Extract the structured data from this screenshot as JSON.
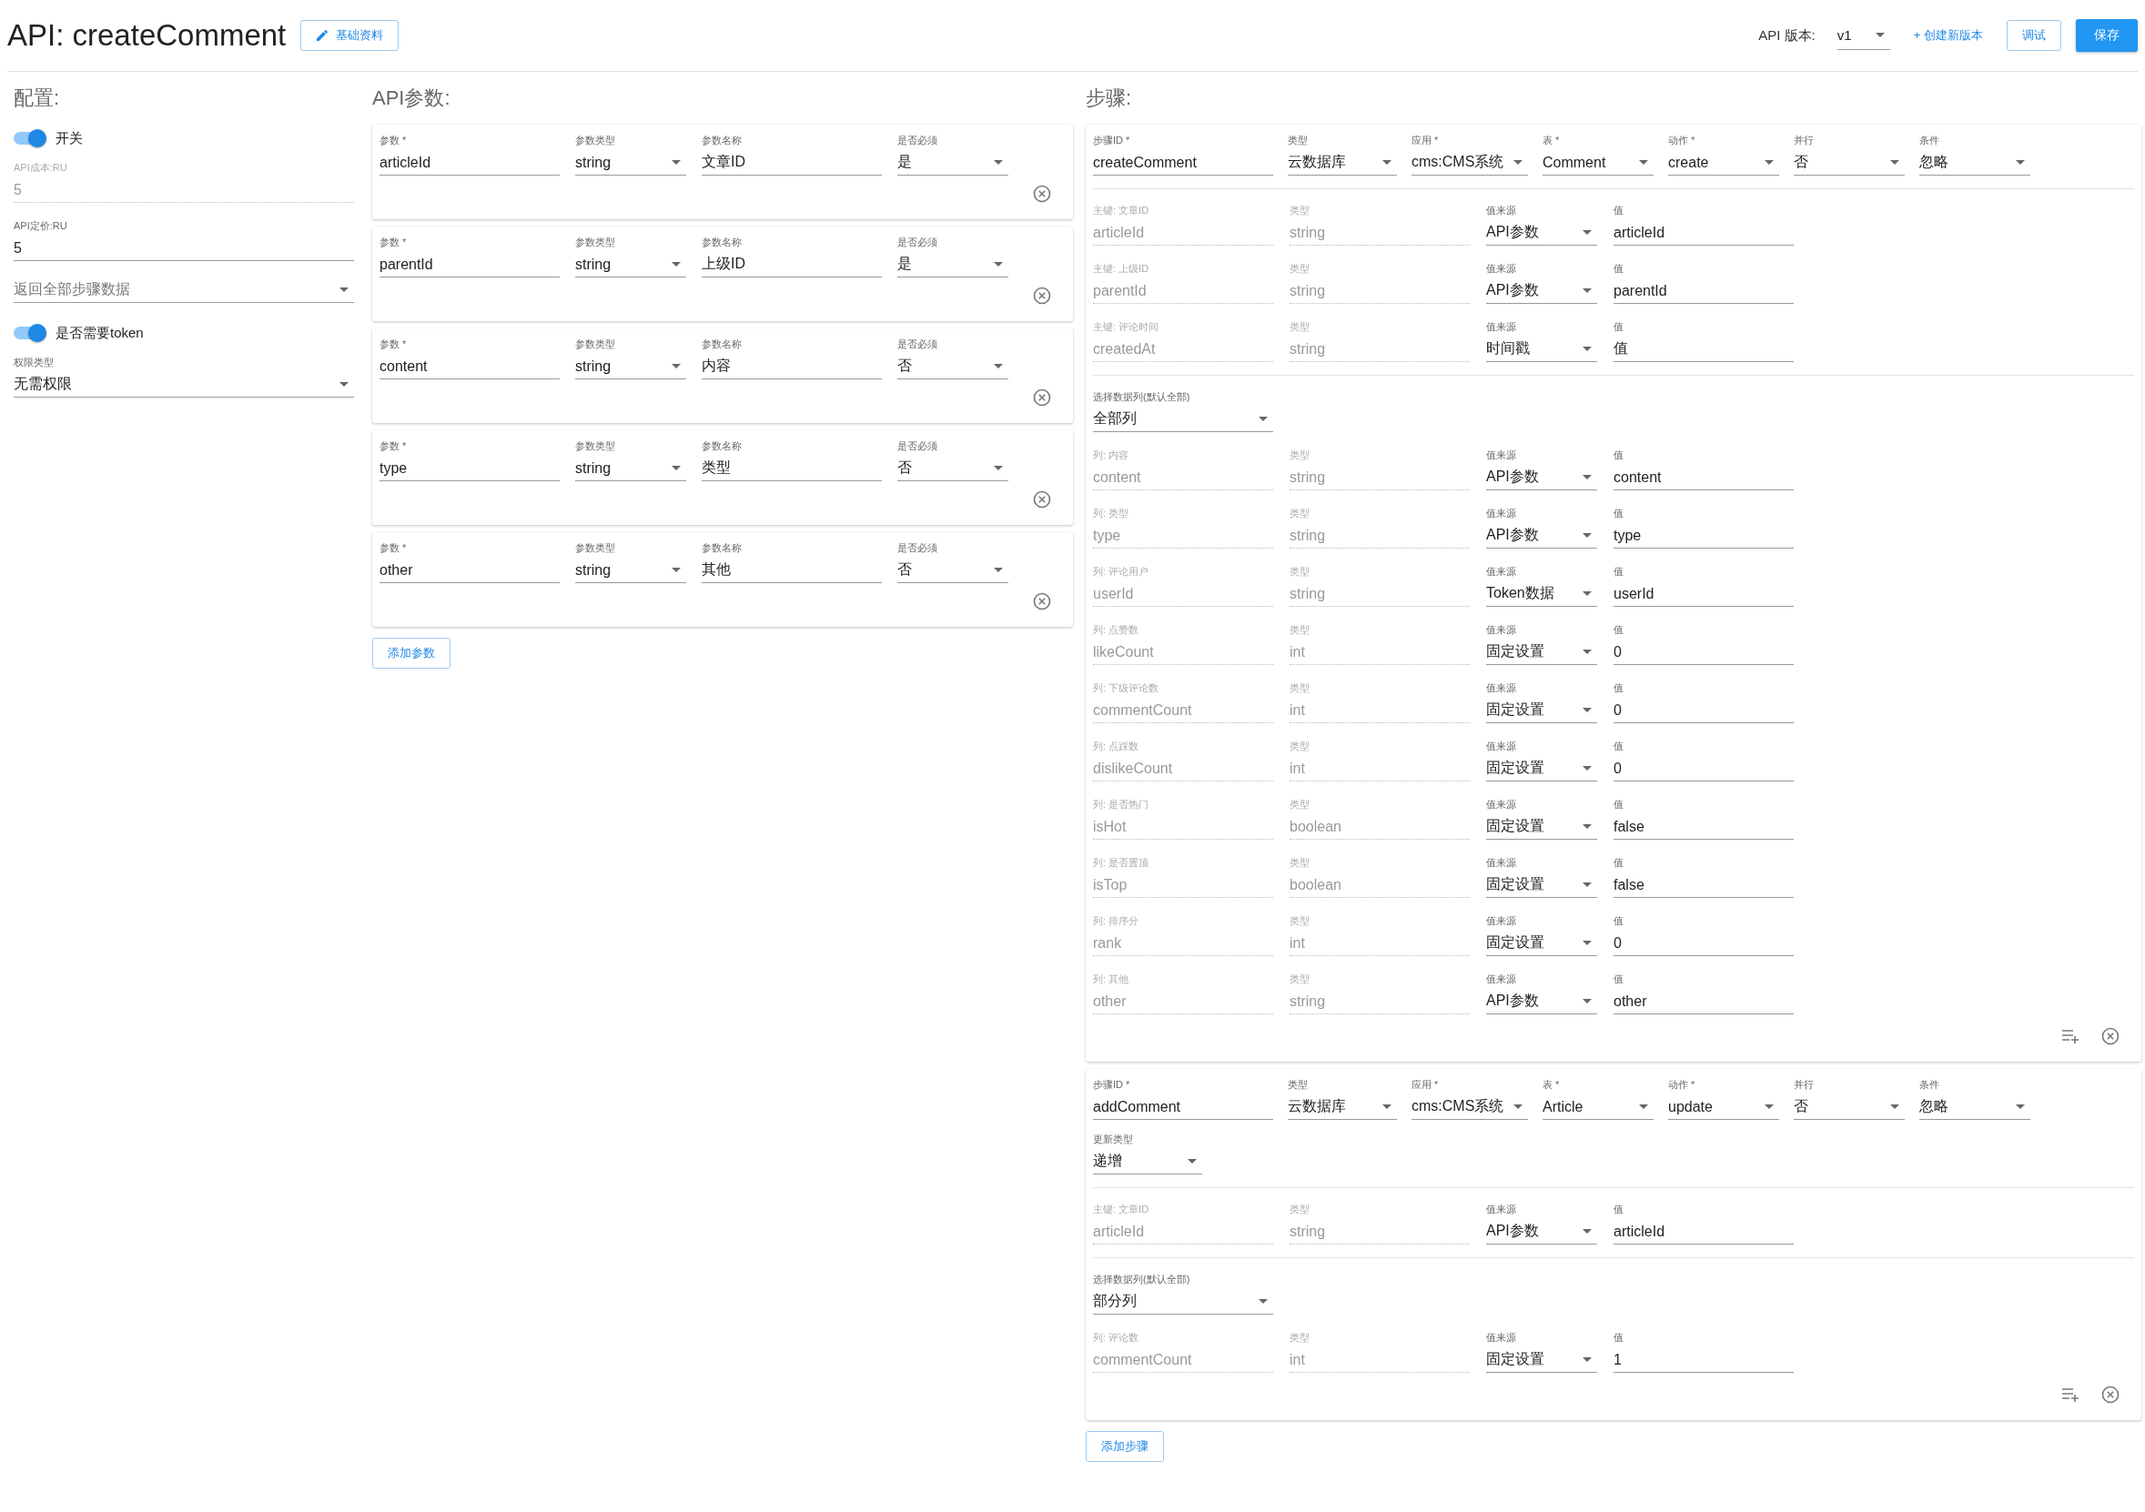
{
  "header": {
    "title": "API: createComment",
    "info_button": "基础资料",
    "version_label": "API 版本:",
    "version": "v1",
    "create_version": "+ 创建新版本",
    "debug_button": "调试",
    "save_button": "保存"
  },
  "config": {
    "title": "配置:",
    "items": [
      {
        "kind": "switch",
        "label": "开关",
        "on": true
      },
      {
        "kind": "readonly",
        "label": "API成本:RU",
        "value": "5"
      },
      {
        "kind": "text",
        "label": "API定价:RU",
        "value": "5"
      },
      {
        "kind": "select",
        "placeholder": "返回全部步骤数据"
      },
      {
        "kind": "switch",
        "label": "是否需要token",
        "on": true
      },
      {
        "kind": "select",
        "label": "权限类型",
        "value": "无需权限"
      }
    ]
  },
  "params": {
    "title": "API参数:",
    "add_button": "添加参数",
    "items": [
      {
        "fields": [
          {
            "kind": "text",
            "label": "参数 *",
            "value": "articleId"
          },
          {
            "kind": "select",
            "label": "参数类型",
            "value": "string"
          },
          {
            "kind": "text",
            "label": "参数名称",
            "value": "文章ID"
          },
          {
            "kind": "select",
            "label": "是否必须",
            "value": "是"
          }
        ]
      },
      {
        "fields": [
          {
            "kind": "text",
            "label": "参数 *",
            "value": "parentId"
          },
          {
            "kind": "select",
            "label": "参数类型",
            "value": "string"
          },
          {
            "kind": "text",
            "label": "参数名称",
            "value": "上级ID"
          },
          {
            "kind": "select",
            "label": "是否必须",
            "value": "是"
          }
        ]
      },
      {
        "fields": [
          {
            "kind": "text",
            "label": "参数 *",
            "value": "content"
          },
          {
            "kind": "select",
            "label": "参数类型",
            "value": "string"
          },
          {
            "kind": "text",
            "label": "参数名称",
            "value": "内容"
          },
          {
            "kind": "select",
            "label": "是否必须",
            "value": "否"
          }
        ]
      },
      {
        "fields": [
          {
            "kind": "text",
            "label": "参数 *",
            "value": "type"
          },
          {
            "kind": "select",
            "label": "参数类型",
            "value": "string"
          },
          {
            "kind": "text",
            "label": "参数名称",
            "value": "类型"
          },
          {
            "kind": "select",
            "label": "是否必须",
            "value": "否"
          }
        ]
      },
      {
        "fields": [
          {
            "kind": "text",
            "label": "参数 *",
            "value": "other"
          },
          {
            "kind": "select",
            "label": "参数类型",
            "value": "string"
          },
          {
            "kind": "text",
            "label": "参数名称",
            "value": "其他"
          },
          {
            "kind": "select",
            "label": "是否必须",
            "value": "否"
          }
        ]
      }
    ]
  },
  "steps": {
    "title": "步骤:",
    "add_button": "添加步骤",
    "items": [
      {
        "header": [
          {
            "kind": "text",
            "label": "步骤ID *",
            "value": "createComment"
          },
          {
            "kind": "select",
            "label": "类型",
            "value": "云数据库"
          },
          {
            "kind": "select",
            "label": "应用 *",
            "value": "cms:CMS系统"
          },
          {
            "kind": "select",
            "label": "表 *",
            "value": "Comment"
          },
          {
            "kind": "select",
            "label": "动作 *",
            "value": "create"
          },
          {
            "kind": "select",
            "label": "并行",
            "value": "否"
          },
          {
            "kind": "select",
            "label": "条件",
            "value": "忽略"
          }
        ],
        "keys": [
          [
            {
              "kind": "readonly",
              "label": "主键: 文章ID",
              "value": "articleId"
            },
            {
              "kind": "readonly",
              "label": "类型",
              "value": "string"
            },
            {
              "kind": "select",
              "label": "值来源",
              "value": "API参数"
            },
            {
              "kind": "text",
              "label": "值",
              "value": "articleId"
            }
          ],
          [
            {
              "kind": "readonly",
              "label": "主键: 上级ID",
              "value": "parentId"
            },
            {
              "kind": "readonly",
              "label": "类型",
              "value": "string"
            },
            {
              "kind": "select",
              "label": "值来源",
              "value": "API参数"
            },
            {
              "kind": "text",
              "label": "值",
              "value": "parentId"
            }
          ],
          [
            {
              "kind": "readonly",
              "label": "主键: 评论时间",
              "value": "createdAt"
            },
            {
              "kind": "readonly",
              "label": "类型",
              "value": "string"
            },
            {
              "kind": "select",
              "label": "值来源",
              "value": "时间戳"
            },
            {
              "kind": "text",
              "label": "值",
              "value": "值"
            }
          ]
        ],
        "column_select": {
          "kind": "select",
          "label": "选择数据列(默认全部)",
          "value": "全部列"
        },
        "columns": [
          [
            {
              "kind": "readonly",
              "label": "列: 内容",
              "value": "content"
            },
            {
              "kind": "readonly",
              "label": "类型",
              "value": "string"
            },
            {
              "kind": "select",
              "label": "值来源",
              "value": "API参数"
            },
            {
              "kind": "text",
              "label": "值",
              "value": "content"
            }
          ],
          [
            {
              "kind": "readonly",
              "label": "列: 类型",
              "value": "type"
            },
            {
              "kind": "readonly",
              "label": "类型",
              "value": "string"
            },
            {
              "kind": "select",
              "label": "值来源",
              "value": "API参数"
            },
            {
              "kind": "text",
              "label": "值",
              "value": "type"
            }
          ],
          [
            {
              "kind": "readonly",
              "label": "列: 评论用户",
              "value": "userId"
            },
            {
              "kind": "readonly",
              "label": "类型",
              "value": "string"
            },
            {
              "kind": "select",
              "label": "值来源",
              "value": "Token数据"
            },
            {
              "kind": "text",
              "label": "值",
              "value": "userId"
            }
          ],
          [
            {
              "kind": "readonly",
              "label": "列: 点赞数",
              "value": "likeCount"
            },
            {
              "kind": "readonly",
              "label": "类型",
              "value": "int"
            },
            {
              "kind": "select",
              "label": "值来源",
              "value": "固定设置"
            },
            {
              "kind": "text",
              "label": "值",
              "value": "0"
            }
          ],
          [
            {
              "kind": "readonly",
              "label": "列: 下级评论数",
              "value": "commentCount"
            },
            {
              "kind": "readonly",
              "label": "类型",
              "value": "int"
            },
            {
              "kind": "select",
              "label": "值来源",
              "value": "固定设置"
            },
            {
              "kind": "text",
              "label": "值",
              "value": "0"
            }
          ],
          [
            {
              "kind": "readonly",
              "label": "列: 点踩数",
              "value": "dislikeCount"
            },
            {
              "kind": "readonly",
              "label": "类型",
              "value": "int"
            },
            {
              "kind": "select",
              "label": "值来源",
              "value": "固定设置"
            },
            {
              "kind": "text",
              "label": "值",
              "value": "0"
            }
          ],
          [
            {
              "kind": "readonly",
              "label": "列: 是否热门",
              "value": "isHot"
            },
            {
              "kind": "readonly",
              "label": "类型",
              "value": "boolean"
            },
            {
              "kind": "select",
              "label": "值来源",
              "value": "固定设置"
            },
            {
              "kind": "text",
              "label": "值",
              "value": "false"
            }
          ],
          [
            {
              "kind": "readonly",
              "label": "列: 是否置顶",
              "value": "isTop"
            },
            {
              "kind": "readonly",
              "label": "类型",
              "value": "boolean"
            },
            {
              "kind": "select",
              "label": "值来源",
              "value": "固定设置"
            },
            {
              "kind": "text",
              "label": "值",
              "value": "false"
            }
          ],
          [
            {
              "kind": "readonly",
              "label": "列: 排序分",
              "value": "rank"
            },
            {
              "kind": "readonly",
              "label": "类型",
              "value": "int"
            },
            {
              "kind": "select",
              "label": "值来源",
              "value": "固定设置"
            },
            {
              "kind": "text",
              "label": "值",
              "value": "0"
            }
          ],
          [
            {
              "kind": "readonly",
              "label": "列: 其他",
              "value": "other"
            },
            {
              "kind": "readonly",
              "label": "类型",
              "value": "string"
            },
            {
              "kind": "select",
              "label": "值来源",
              "value": "API参数"
            },
            {
              "kind": "text",
              "label": "值",
              "value": "other"
            }
          ]
        ]
      },
      {
        "header": [
          {
            "kind": "text",
            "label": "步骤ID *",
            "value": "addComment"
          },
          {
            "kind": "select",
            "label": "类型",
            "value": "云数据库"
          },
          {
            "kind": "select",
            "label": "应用 *",
            "value": "cms:CMS系统"
          },
          {
            "kind": "select",
            "label": "表 *",
            "value": "Article"
          },
          {
            "kind": "select",
            "label": "动作 *",
            "value": "update"
          },
          {
            "kind": "select",
            "label": "并行",
            "value": "否"
          },
          {
            "kind": "select",
            "label": "条件",
            "value": "忽略"
          }
        ],
        "extra": {
          "kind": "select",
          "label": "更新类型",
          "value": "递增"
        },
        "keys": [
          [
            {
              "kind": "readonly",
              "label": "主键: 文章ID",
              "value": "articleId"
            },
            {
              "kind": "readonly",
              "label": "类型",
              "value": "string"
            },
            {
              "kind": "select",
              "label": "值来源",
              "value": "API参数"
            },
            {
              "kind": "text",
              "label": "值",
              "value": "articleId"
            }
          ]
        ],
        "column_select": {
          "kind": "select",
          "label": "选择数据列(默认全部)",
          "value": "部分列"
        },
        "columns": [
          [
            {
              "kind": "readonly",
              "label": "列: 评论数",
              "value": "commentCount"
            },
            {
              "kind": "readonly",
              "label": "类型",
              "value": "int"
            },
            {
              "kind": "select",
              "label": "值来源",
              "value": "固定设置"
            },
            {
              "kind": "text",
              "label": "值",
              "value": "1"
            }
          ]
        ]
      }
    ]
  }
}
